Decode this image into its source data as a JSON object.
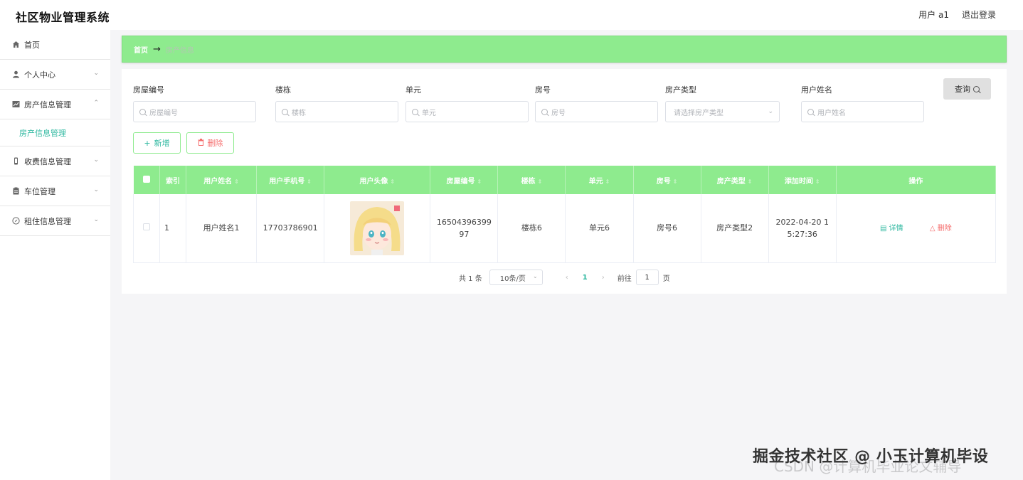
{
  "header": {
    "title": "社区物业管理系统",
    "user": "用户 a1",
    "logout": "退出登录"
  },
  "sidebar": {
    "items": [
      {
        "label": "首页",
        "icon": "home-icon"
      },
      {
        "label": "个人中心",
        "icon": "user-icon"
      },
      {
        "label": "房产信息管理",
        "icon": "chart-icon"
      },
      {
        "label": "收费信息管理",
        "icon": "phone-icon"
      },
      {
        "label": "车位管理",
        "icon": "clipboard-icon"
      },
      {
        "label": "租住信息管理",
        "icon": "compass-icon"
      }
    ],
    "subitem": "房产信息管理"
  },
  "breadcrumb": {
    "home": "首页",
    "arrow": "→",
    "current": "房产信息"
  },
  "filters": {
    "house_no": {
      "label": "房屋编号",
      "placeholder": "房屋编号"
    },
    "building": {
      "label": "楼栋",
      "placeholder": "楼栋"
    },
    "unit": {
      "label": "单元",
      "placeholder": "单元"
    },
    "room": {
      "label": "房号",
      "placeholder": "房号"
    },
    "house_type": {
      "label": "房产类型",
      "placeholder": "请选择房产类型"
    },
    "user_name": {
      "label": "用户姓名",
      "placeholder": "用户姓名"
    },
    "query_label": "查询"
  },
  "actions": {
    "add": "新增",
    "delete": "删除"
  },
  "table": {
    "columns": [
      "索引",
      "用户姓名",
      "用户手机号",
      "用户头像",
      "房屋编号",
      "楼栋",
      "单元",
      "房号",
      "房产类型",
      "添加时间",
      "操作"
    ],
    "rows": [
      {
        "index": "1",
        "user_name": "用户姓名1",
        "phone": "17703786901",
        "house_no": "1650439639997",
        "building": "楼栋6",
        "unit": "单元6",
        "room": "房号6",
        "type": "房产类型2",
        "time": "2022-04-20 15:27:36",
        "detail": "详情",
        "delete": "删除"
      }
    ]
  },
  "pagination": {
    "total": "共 1 条",
    "page_size": "10条/页",
    "current": "1",
    "goto_label": "前往",
    "goto_value": "1",
    "page_suffix": "页"
  },
  "watermark": {
    "line1": "掘金技术社区 @ 小玉计算机毕设",
    "line2": "CSDN @计算机毕业论文辅导"
  }
}
